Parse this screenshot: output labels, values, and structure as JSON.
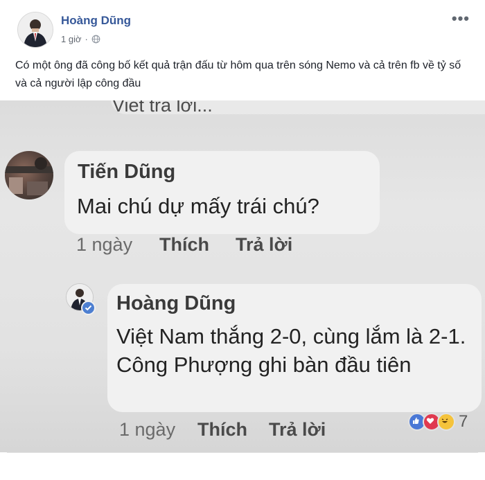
{
  "post": {
    "author": "Hoàng Dũng",
    "time": "1 giờ",
    "dot": "·",
    "more": "•••",
    "text": "Có một ông đã công bố kết quả trận đấu từ hôm qua trên sóng Nemo và cả trên fb về tỷ số và cả người lập công đầu"
  },
  "photo": {
    "top_fragment": "Viet tra lời...",
    "comment1": {
      "name": "Tiến Dũng",
      "text": "Mai chú dự mấy trái chú?",
      "time": "1 ngày",
      "like": "Thích",
      "reply": "Trả lời"
    },
    "comment2": {
      "name": "Hoàng Dũng",
      "text": "Việt Nam thắng 2-0, cùng lắm là 2-1. Công Phượng ghi bàn đầu tiên",
      "time": "1 ngày",
      "like": "Thích",
      "reply": "Trả lời",
      "reaction_count": "7"
    }
  },
  "colors": {
    "link_blue": "#365899",
    "like_blue": "#4a78d6",
    "love_red": "#e0394f",
    "haha_yellow": "#f5c33b"
  }
}
